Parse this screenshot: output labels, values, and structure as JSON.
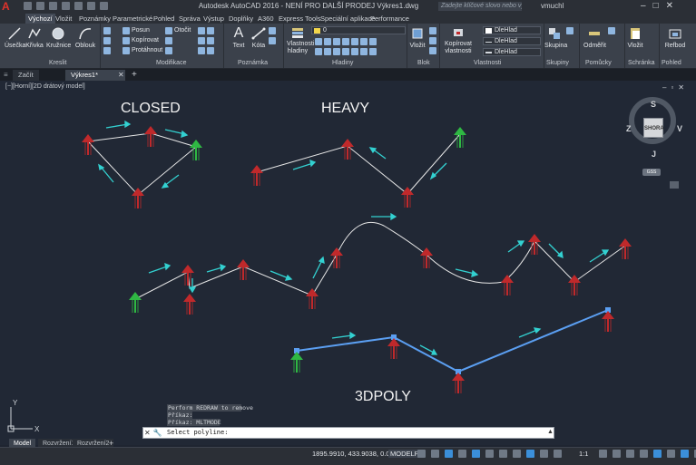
{
  "app": {
    "logo": "A",
    "title": "Autodesk AutoCAD 2016 - NENÍ PRO DALŠÍ PRODEJ   Výkres1.dwg",
    "search_placeholder": "Zadejte klíčové slovo nebo výraz",
    "user": "vmuchl"
  },
  "ribbon_tabs": [
    "Výchozí",
    "Vložit",
    "Poznámky",
    "Parametrické",
    "Pohled",
    "Správa",
    "Výstup",
    "Doplňky",
    "A360",
    "Express Tools",
    "Speciální aplikace",
    "Performance"
  ],
  "ribbon": {
    "draw": {
      "line": "Úsečka",
      "polyline": "Křivka",
      "circle": "Kružnice",
      "arc": "Oblouk",
      "panel": "Kreslit"
    },
    "modify": {
      "move": "Posun",
      "rotate": "Otočit",
      "copy": "Kopírovat",
      "mirror": "Protáhnout",
      "panel": "Modifikace"
    },
    "annotation": {
      "text": "Text",
      "dimension": "Kóta",
      "panel": "Poznámka"
    },
    "layers": {
      "properties": "Vlastnosti hladiny",
      "current": "0",
      "panel": "Hladiny"
    },
    "block": {
      "insert": "Vložit",
      "panel": "Blok"
    },
    "properties": {
      "match": "Kopírovat vlastnosti",
      "color": "DleHlad",
      "linetype": "DleHlad",
      "lineweight": "DleHlad",
      "panel": "Vlastnosti"
    },
    "groups": {
      "group": "Skupina",
      "panel": "Skupiny"
    },
    "utilities": {
      "measure": "Odměřit",
      "panel": "Pomůcky"
    },
    "clipboard": {
      "paste": "Vložit",
      "panel": "Schránka"
    },
    "view": {
      "base": "Refbod",
      "panel": "Pohled"
    }
  },
  "file_tabs": [
    "Začít",
    "Výkres1*"
  ],
  "viewport": {
    "label": "[−][Horní][2D drátový model]",
    "labels": {
      "closed": "CLOSED",
      "heavy": "HEAVY",
      "poly3d": "3DPOLY"
    },
    "viewcube": {
      "top": "SHORA",
      "n": "S",
      "s": "J",
      "e": "V",
      "w": "Z",
      "wcs": "GSS"
    },
    "ucs_y": "Y",
    "ucs_x": "X"
  },
  "command": {
    "history": [
      "Perform REDRAW to remove",
      "Příkaz:",
      "Příkaz: MLTMODE"
    ],
    "prompt": "Select polyline:"
  },
  "layout_tabs": [
    "Model",
    "Rozvržení1",
    "Rozvržení2"
  ],
  "status": {
    "coords": "1895.9910, 433.9038, 0.0000",
    "mode": "MODELP",
    "scale": "1:1"
  },
  "colors": {
    "background": "#212835",
    "polyline": "#e6e6e6",
    "poly3d": "#5b9ff2",
    "arrow_red": "#c0292b",
    "arrow_green": "#2fb843",
    "direction_cyan": "#33d1d1"
  }
}
